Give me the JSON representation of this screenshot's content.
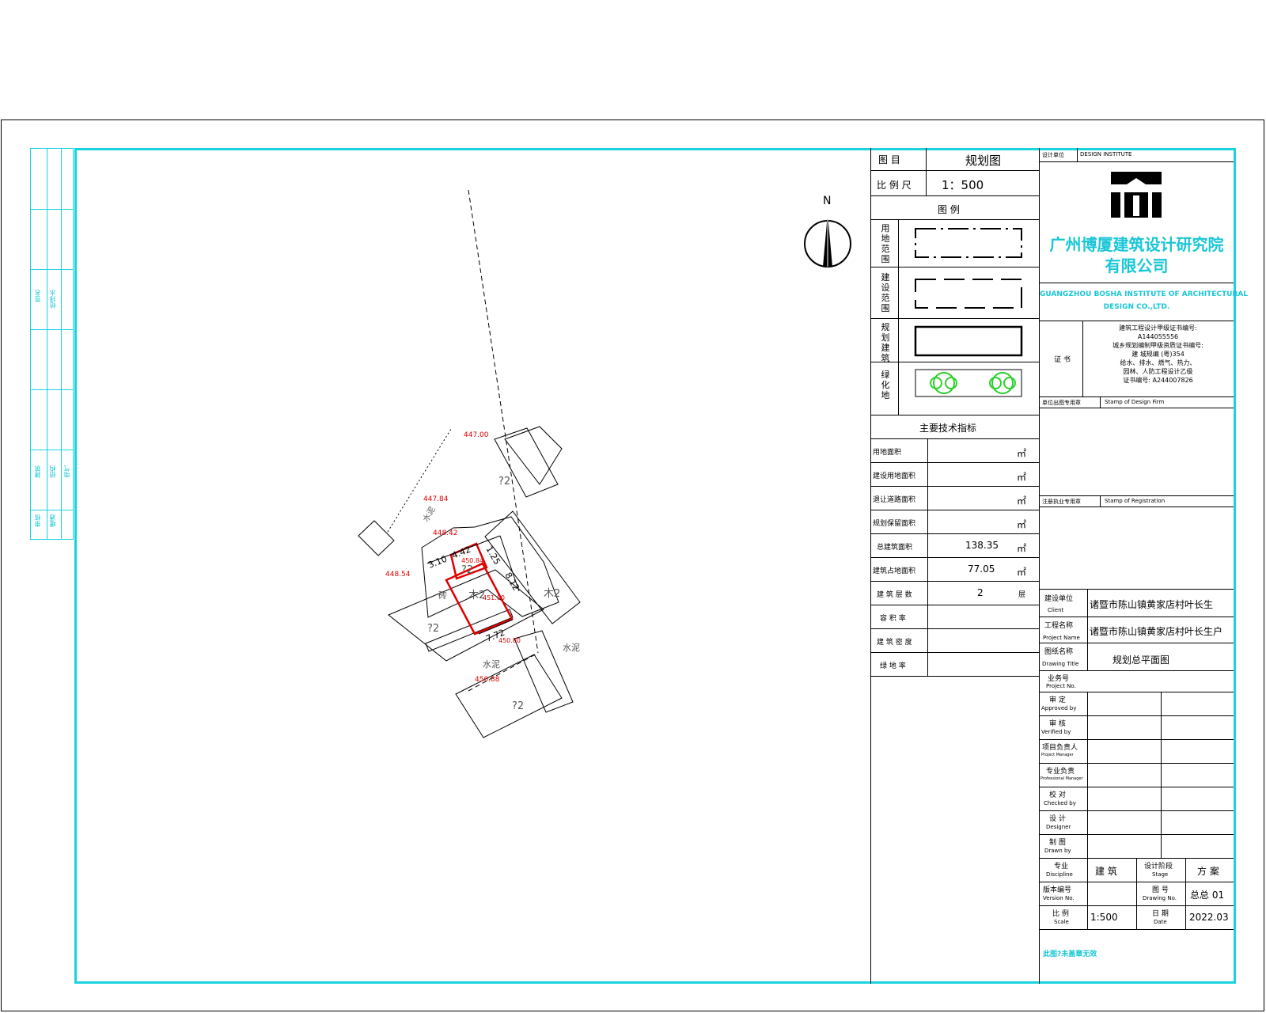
{
  "colors": {
    "frame": "#19d3df",
    "company": "#19c6d6",
    "survey_point": "#e00000",
    "plan_outline": "#e00000",
    "green": "#2bd12b"
  },
  "left_strip": {
    "labels": [
      "签名",
      "审核",
      "建筑",
      "结构",
      "给排水",
      "电气",
      "暖通"
    ]
  },
  "title_table": {
    "drawing_title_label": "图 目",
    "drawing_title_value": "规划图",
    "scale_label": "比 例 尺",
    "scale_value": "1：500",
    "legend_title": "图 例",
    "legend": [
      {
        "label": "用地范围"
      },
      {
        "label": "建设范围"
      },
      {
        "label": "规划建筑"
      },
      {
        "label": "绿化地"
      }
    ],
    "indicators_title": "主要技术指标",
    "indicators": [
      {
        "label": "用地面积",
        "value": "",
        "unit": "㎡"
      },
      {
        "label": "建设用地面积",
        "value": "",
        "unit": "㎡"
      },
      {
        "label": "退让道路面积",
        "value": "",
        "unit": "㎡"
      },
      {
        "label": "规划保留面积",
        "value": "",
        "unit": "㎡"
      },
      {
        "label": "总建筑面积",
        "value": "138.35",
        "unit": "㎡"
      },
      {
        "label": "建筑占地面积",
        "value": "77.05",
        "unit": "㎡"
      },
      {
        "label": "建 筑 层 数",
        "value": "2",
        "unit": "层"
      },
      {
        "label": "容 积 率",
        "value": "",
        "unit": ""
      },
      {
        "label": "建 筑 密 度",
        "value": "",
        "unit": ""
      },
      {
        "label": "绿 地 率",
        "value": "",
        "unit": ""
      }
    ]
  },
  "company": {
    "design_unit_label": "设计单位",
    "design_unit_en": "DESIGN INSTITUTE",
    "name_cn_line1": "广州博厦建筑设计研究院",
    "name_cn_line2": "有限公司",
    "name_en_line1": "GUANGZHOU BOSHA INSTITUTE OF ARCHITECTURAL",
    "name_en_line2": "DESIGN CO.,LTD.",
    "cert_label": "证 书",
    "cert_lines": [
      "建筑工程设计甲级证书编号:",
      "A144055556",
      "城乡规划编制甲级资质证书编号:",
      "建 城规编 (粤)354",
      "给水、排水、燃气、热力、",
      "园林、人防工程设计乙级",
      "证书编号: A244007826"
    ],
    "stamp_label": "单位出图专用章",
    "stamp_en": "Stamp of Design Firm",
    "reg_label": "注册执业专用章",
    "reg_en": "Stamp of Registration"
  },
  "project": {
    "client_label": "建设单位",
    "client_en": "Client",
    "client_value": "诸暨市陈山镇黄家店村叶长生",
    "project_label": "工程名称",
    "project_en": "Project Name",
    "project_value": "诸暨市陈山镇黄家店村叶长生户",
    "drawing_label": "图纸名称",
    "drawing_en": "Drawing Title",
    "drawing_value": "规划总平面图",
    "project_no_label": "业务号",
    "project_no_en": "Project No.",
    "roles": [
      {
        "cn": "审 定",
        "en": "Approved by"
      },
      {
        "cn": "审 核",
        "en": "Verified by"
      },
      {
        "cn": "项目负责人",
        "en": "Project Manager"
      },
      {
        "cn": "专业负责",
        "en": "Professional Manager"
      },
      {
        "cn": "校 对",
        "en": "Checked by"
      },
      {
        "cn": "设 计",
        "en": "Designer"
      },
      {
        "cn": "制 图",
        "en": "Drawn by"
      }
    ],
    "discipline_label": "专业",
    "discipline_en": "Discipline",
    "discipline_value": "建 筑",
    "stage_label": "设计阶段",
    "stage_en": "Stage",
    "stage_value": "方 案",
    "version_label": "版本编号",
    "version_en": "Version No.",
    "version_value": "",
    "drawing_no_label": "图 号",
    "drawing_no_en": "Drawing No.",
    "drawing_no_value": "总总 01",
    "scale_label": "比 例",
    "scale_en": "Scale",
    "scale_value": "1:500",
    "date_label": "日 期",
    "date_en": "Date",
    "date_value": "2022.03",
    "footer_note": "此图?未盖章无效"
  },
  "site_plan": {
    "north_label": "N",
    "elevations": [
      "447.00",
      "447.84",
      "448.42",
      "448.54",
      "450.84",
      "451.00",
      "450.80",
      "450.88"
    ],
    "dimensions": [
      "3.10",
      "4.42",
      "1.25",
      "8.12",
      "7.72"
    ],
    "building_labels": [
      "?2",
      "?2",
      "木2",
      "木2",
      "?2",
      "?2",
      "砖"
    ],
    "ground_labels": [
      "水泥",
      "水泥",
      "水泥"
    ]
  }
}
